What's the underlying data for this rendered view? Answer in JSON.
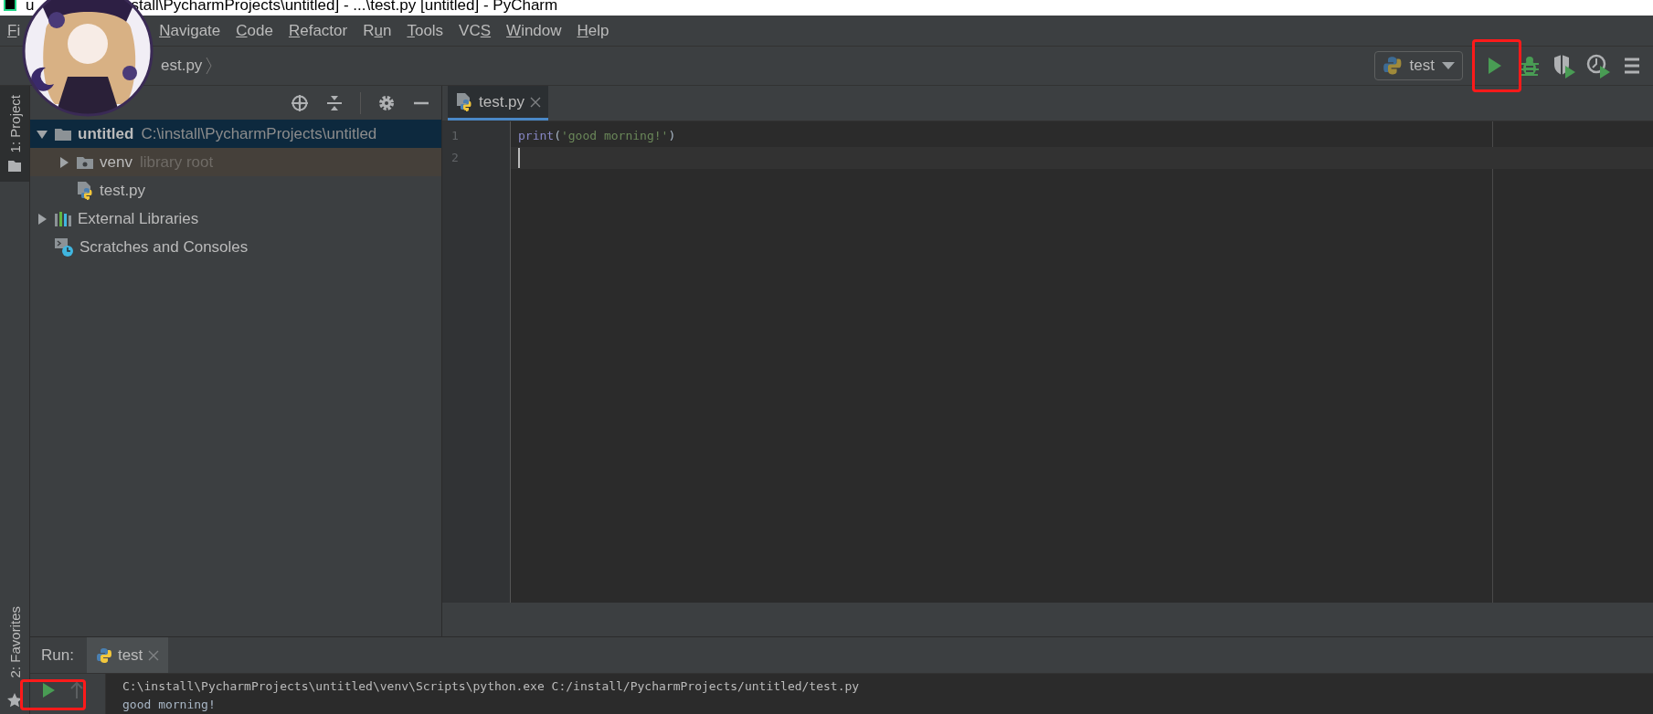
{
  "title_bar": {
    "texts": [
      "u",
      "stall\\PycharmProjects\\untitled] - ...\\test.py [untitled] - PyCharm"
    ]
  },
  "menu": [
    {
      "key": "F",
      "after": "i"
    },
    {
      "key": "N",
      "after": "avigate"
    },
    {
      "key": "C",
      "after": "ode"
    },
    {
      "key": "R",
      "after": "efactor"
    },
    {
      "before": "R",
      "key": "u",
      "after": "n"
    },
    {
      "key": "T",
      "after": "ools"
    },
    {
      "before": "VC",
      "key": "S"
    },
    {
      "key": "W",
      "after": "indow"
    },
    {
      "key": "H",
      "after": "elp"
    }
  ],
  "nav_bar": {
    "breadcrumb": "est.py",
    "run_config": "test"
  },
  "tool_stripe": {
    "top": [
      {
        "key": "1",
        "after": ": Project",
        "selected": true
      }
    ],
    "bottom": [
      {
        "key": "2",
        "after": ": Favorites",
        "selected": false
      }
    ]
  },
  "project_tree": [
    {
      "label": "untitled",
      "note": "C:\\install\\PycharmProjects\\untitled",
      "kind": "project-root",
      "expanded": true,
      "selected": true,
      "children": [
        {
          "label": "venv",
          "note": "library root",
          "kind": "library-folder",
          "expanded": false,
          "selected": false
        },
        {
          "label": "test.py",
          "kind": "python-file",
          "selected": false
        }
      ]
    },
    {
      "label": "External Libraries",
      "kind": "libraries",
      "expanded": false,
      "selected": false
    },
    {
      "label": "Scratches and Consoles",
      "kind": "scratches",
      "selected": false
    }
  ],
  "editor": {
    "tabs": [
      {
        "label": "test.py",
        "selected": true
      }
    ],
    "lines": [
      {
        "number": "1",
        "current": false,
        "tokens": [
          {
            "text": "print",
            "kind": "builtin"
          },
          {
            "text": "(",
            "kind": "punct"
          },
          {
            "text": "'good morning!'",
            "kind": "string"
          },
          {
            "text": ")",
            "kind": "punct"
          }
        ]
      },
      {
        "number": "2",
        "current": true
      }
    ]
  },
  "run_panel": {
    "label": "Run:",
    "tabs": [
      {
        "label": "test",
        "selected": true
      }
    ],
    "console": [
      {
        "text": "C:\\install\\PycharmProjects\\untitled\\venv\\Scripts\\python.exe C:/install/PycharmProjects/untitled/test.py",
        "kind": "command"
      },
      {
        "text": "good morning!",
        "kind": "output"
      }
    ]
  }
}
